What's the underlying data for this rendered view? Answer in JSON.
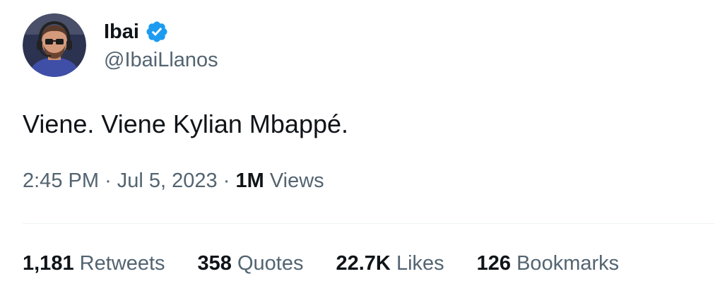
{
  "author": {
    "display_name": "Ibai",
    "handle": "@IbaiLlanos",
    "verified": true,
    "avatar_icon": "profile-photo"
  },
  "tweet": {
    "text": "Viene. Viene Kylian Mbappé."
  },
  "meta": {
    "time": "2:45 PM",
    "separator": "·",
    "date": "Jul 5, 2023",
    "views_count": "1M",
    "views_label": "Views"
  },
  "stats": {
    "retweets_count": "1,181",
    "retweets_label": "Retweets",
    "quotes_count": "358",
    "quotes_label": "Quotes",
    "likes_count": "22.7K",
    "likes_label": "Likes",
    "bookmarks_count": "126",
    "bookmarks_label": "Bookmarks"
  },
  "colors": {
    "primary_text": "#0f1419",
    "secondary_text": "#536471",
    "verified_blue": "#1d9bf0",
    "divider": "#eff3f4"
  }
}
